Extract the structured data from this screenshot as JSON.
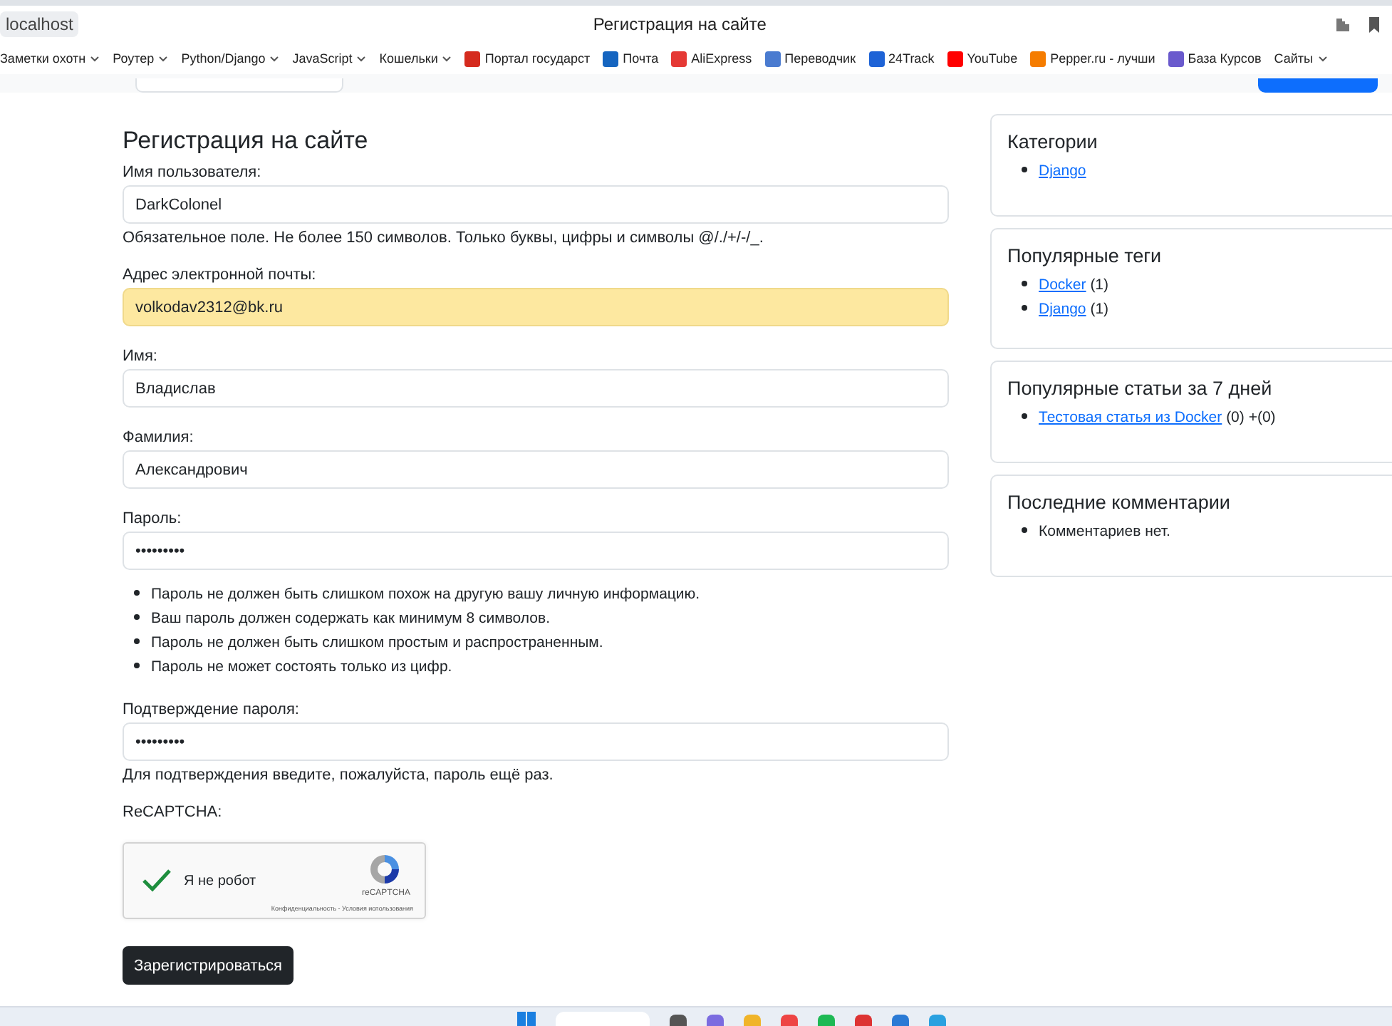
{
  "browser": {
    "address": "localhost",
    "title": "Регистрация на сайте"
  },
  "bookmarks": [
    {
      "kind": "folder",
      "label": "Заметки охотн"
    },
    {
      "kind": "folder",
      "label": "Роутер"
    },
    {
      "kind": "folder",
      "label": "Python/Django"
    },
    {
      "kind": "folder",
      "label": "JavaScript"
    },
    {
      "kind": "folder",
      "label": "Кошельки"
    },
    {
      "kind": "link",
      "label": "Портал государст",
      "color": "#d52b1e"
    },
    {
      "kind": "link",
      "label": "Почта",
      "color": "#1565c0"
    },
    {
      "kind": "link",
      "label": "AliExpress",
      "color": "#e53935"
    },
    {
      "kind": "link",
      "label": "Переводчик",
      "color": "#4a7bd0"
    },
    {
      "kind": "link",
      "label": "24Track",
      "color": "#1e63d6"
    },
    {
      "kind": "link",
      "label": "YouTube",
      "color": "#ff0000"
    },
    {
      "kind": "link",
      "label": "Pepper.ru - лучши",
      "color": "#f57c00"
    },
    {
      "kind": "link",
      "label": "База Курсов",
      "color": "#6a5acd"
    },
    {
      "kind": "folder",
      "label": "Сайты"
    }
  ],
  "form": {
    "title": "Регистрация на сайте",
    "fields": [
      {
        "label": "Имя пользователя:",
        "value": "DarkColonel",
        "autofilled": false,
        "help": "Обязательное поле. Не более 150 символов. Только буквы, цифры и символы @/./+/-/_."
      },
      {
        "label": "Адрес электронной почты:",
        "value": "volkodav2312@bk.ru",
        "autofilled": true
      },
      {
        "label": "Имя:",
        "value": "Владислав",
        "autofilled": false
      },
      {
        "label": "Фамилия:",
        "value": "Александрович",
        "autofilled": false
      },
      {
        "label": "Пароль:",
        "value": "•••••••••",
        "autofilled": false,
        "rules": [
          "Пароль не должен быть слишком похож на другую вашу личную информацию.",
          "Ваш пароль должен содержать как минимум 8 символов.",
          "Пароль не должен быть слишком простым и распространенным.",
          "Пароль не может состоять только из цифр."
        ]
      },
      {
        "label": "Подтверждение пароля:",
        "value": "•••••••••",
        "autofilled": false,
        "help": "Для подтверждения введите, пожалуйста, пароль ещё раз."
      }
    ],
    "captcha": {
      "label": "ReCAPTCHA:",
      "checked": true,
      "text": "Я не робот",
      "brand": "reCAPTCHA",
      "terms": "Конфиденциальность - Условия использования"
    },
    "submit": "Зарегистрироваться"
  },
  "sidebar": [
    {
      "title": "Категории",
      "items": [
        {
          "link": "Django"
        }
      ]
    },
    {
      "title": "Популярные теги",
      "items": [
        {
          "link": "Docker",
          "note": "(1)"
        },
        {
          "link": "Django",
          "note": "(1)"
        }
      ]
    },
    {
      "title": "Популярные статьи за 7 дней",
      "items": [
        {
          "link": "Тестовая статья из Docker",
          "note": "(0) +(0)"
        }
      ]
    },
    {
      "title": "Последние комментарии",
      "items": [
        {
          "text": "Комментариев нет."
        }
      ]
    }
  ]
}
